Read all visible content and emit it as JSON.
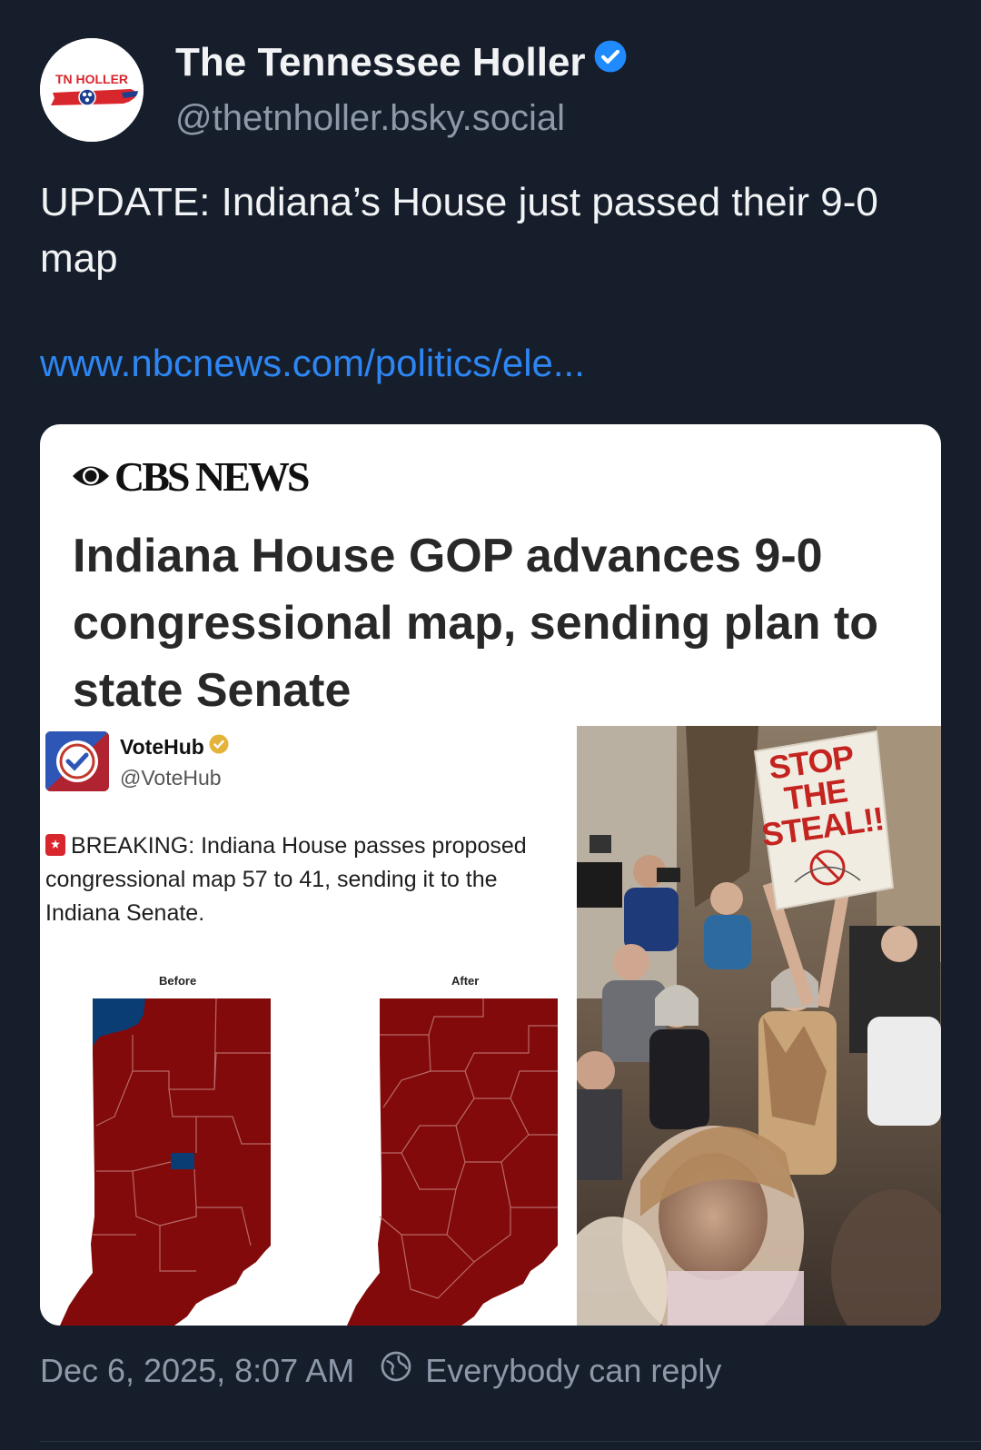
{
  "author": {
    "display_name": "The Tennessee Holler",
    "handle": "@thetnholler.bsky.social",
    "avatar_text": "TN HOLLER",
    "verified": true
  },
  "post": {
    "text": "UPDATE: Indiana’s House just passed their 9-0 map",
    "link": "www.nbcnews.com/politics/ele..."
  },
  "card": {
    "publisher": "CBS NEWS",
    "headline": "Indiana House GOP advances 9-0 congressional map, sending plan to state Senate",
    "embedded_post": {
      "name": "VoteHub",
      "handle": "@VoteHub",
      "text": "BREAKING: Indiana House passes proposed congressional map 57 to 41, sending it to the Indiana Senate."
    },
    "maps": {
      "before_label": "Before",
      "after_label": "After",
      "republican_color": "#820a0a",
      "democrat_color": "#0b3d75"
    },
    "photo": {
      "sign_line1": "STOP",
      "sign_line2": "THE",
      "sign_line3": "STEAL!!"
    }
  },
  "footer": {
    "timestamp": "Dec 6, 2025, 8:07 AM",
    "reply_setting": "Everybody can reply"
  },
  "colors": {
    "background": "#161e2b",
    "text": "#f1f3f5",
    "muted": "#8d98a8",
    "link": "#2d86f3",
    "verified": "#208bfe"
  }
}
